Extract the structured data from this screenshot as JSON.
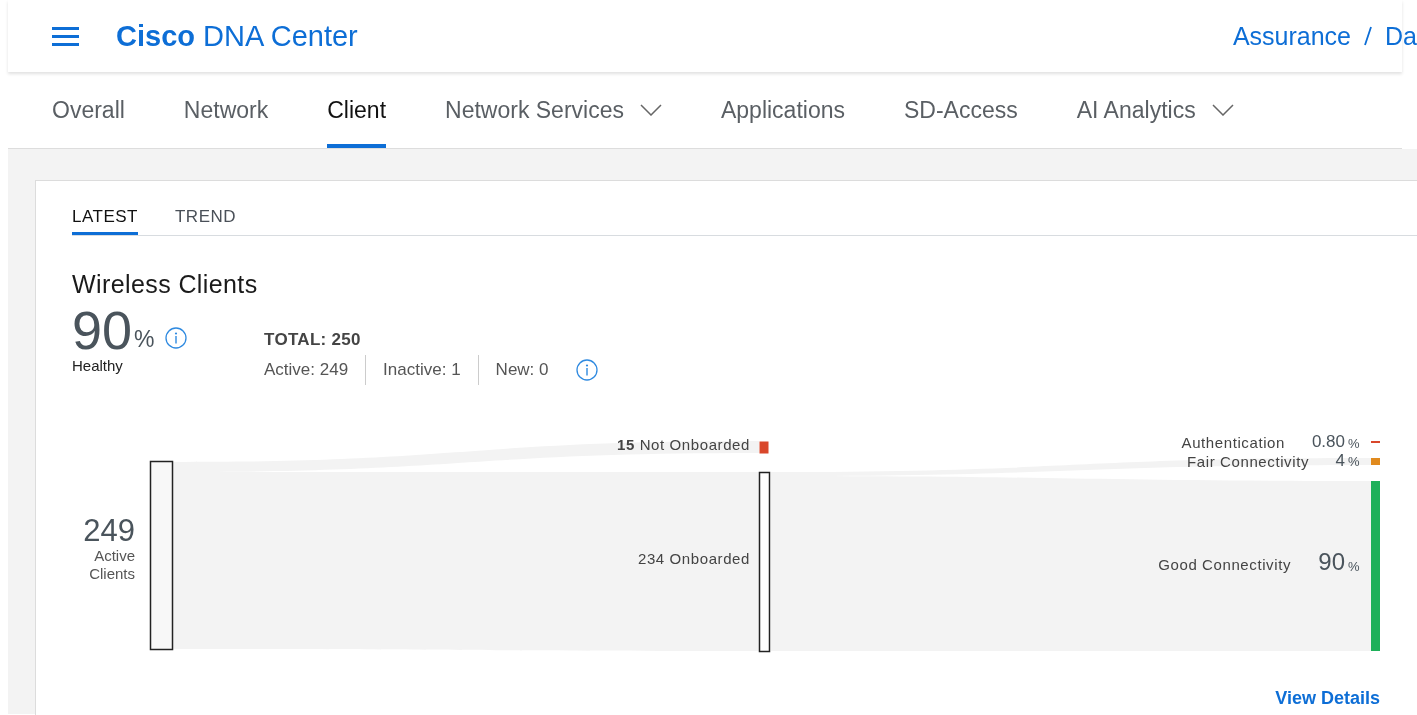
{
  "header": {
    "brand_bold": "Cisco",
    "brand": "DNA Center",
    "breadcrumb": [
      "Assurance",
      "Da"
    ]
  },
  "tabs": [
    {
      "label": "Overall",
      "selected": false,
      "dropdown": false
    },
    {
      "label": "Network",
      "selected": false,
      "dropdown": false
    },
    {
      "label": "Client",
      "selected": true,
      "dropdown": false
    },
    {
      "label": "Network Services",
      "selected": false,
      "dropdown": true
    },
    {
      "label": "Applications",
      "selected": false,
      "dropdown": false
    },
    {
      "label": "SD-Access",
      "selected": false,
      "dropdown": false
    },
    {
      "label": "AI Analytics",
      "selected": false,
      "dropdown": true
    }
  ],
  "subtabs": [
    {
      "label": "LATEST",
      "selected": true
    },
    {
      "label": "TREND",
      "selected": false
    }
  ],
  "panel": {
    "title": "Wireless Clients",
    "health_value": "90",
    "health_unit": "%",
    "health_label": "Healthy",
    "total": "TOTAL: 250",
    "stats": [
      "Active: 249",
      "Inactive: 1",
      "New: 0"
    ]
  },
  "sankey": {
    "source": {
      "value": "249",
      "label": "Active Clients"
    },
    "onboarding": [
      {
        "label": "**15** Not Onboarded",
        "color": "#d9472b"
      },
      {
        "label": "234 Onboarded",
        "color": "#ffffff"
      }
    ],
    "connectivity": [
      {
        "label": "Authentication",
        "value": "0.80",
        "unit": "%",
        "color": "#d9472b"
      },
      {
        "label": "Fair Connectivity",
        "value": "4",
        "unit": "%",
        "color": "#e08a1e"
      },
      {
        "label": "Good Connectivity",
        "value": "90",
        "unit": "%",
        "color": "#1eb05a"
      }
    ]
  },
  "link": "View Details"
}
